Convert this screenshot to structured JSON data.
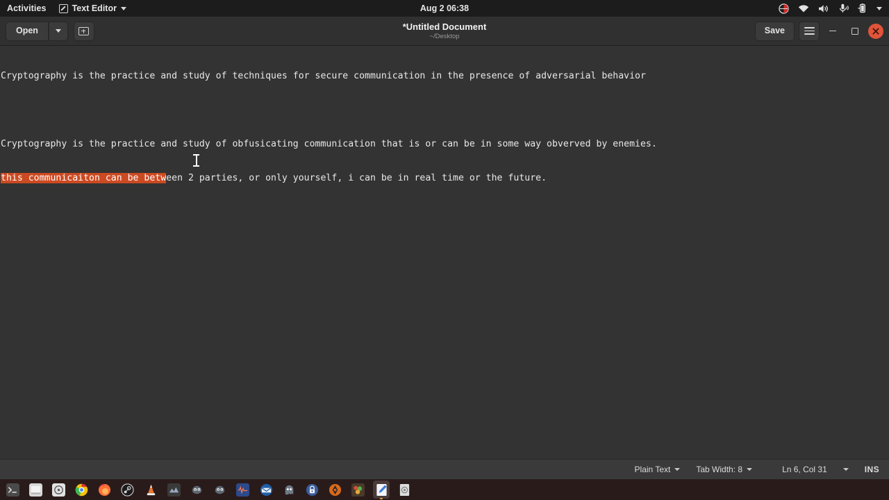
{
  "topbar": {
    "activities": "Activities",
    "app_name": "Text Editor",
    "app_icon": "text-editor-icon",
    "clock": "Aug 2  06:38",
    "tray": [
      {
        "name": "screencast-recording-icon"
      },
      {
        "name": "wifi-icon"
      },
      {
        "name": "volume-icon"
      },
      {
        "name": "microphone-icon"
      },
      {
        "name": "battery-icon"
      },
      {
        "name": "system-menu-chevron-icon"
      }
    ]
  },
  "headerbar": {
    "open_label": "Open",
    "open_dropdown_icon": "chevron-down-icon",
    "new_document_icon": "new-document-icon",
    "title": "*Untitled Document",
    "subtitle": "~/Desktop",
    "save_label": "Save",
    "menu_icon": "hamburger-menu-icon",
    "minimize_icon": "minimize-icon",
    "maximize_icon": "maximize-icon",
    "close_icon": "close-icon",
    "close_color": "#e0543a"
  },
  "editor": {
    "background": "#333333",
    "text_color": "#e8e8e8",
    "selection_color": "#cc4a22",
    "lines": [
      {
        "type": "text",
        "text": "Cryptography is the practice and study of techniques for secure communication in the presence of adversarial behavior"
      },
      {
        "type": "blank",
        "text": ""
      },
      {
        "type": "text",
        "text": "Cryptography is the practice and study of obfusicating communication that is or can be in some way obverved by enemies."
      },
      {
        "type": "split",
        "selected": "this communicaiton can be betw",
        "rest": "een 2 parties, or only yourself, i can be in real time or the future."
      }
    ]
  },
  "statusbar": {
    "language": "Plain Text",
    "tab_width": "Tab Width: 8",
    "position": "Ln 6, Col 31",
    "overwrite_mode": "INS"
  },
  "dock": {
    "items": [
      {
        "name": "terminal",
        "icon": "terminal-icon",
        "active": false
      },
      {
        "name": "files",
        "icon": "files-icon",
        "active": false
      },
      {
        "name": "disks",
        "icon": "disks-icon",
        "active": false
      },
      {
        "name": "google-chrome",
        "icon": "chrome-icon",
        "active": false
      },
      {
        "name": "firefox",
        "icon": "firefox-icon",
        "active": false
      },
      {
        "name": "steam",
        "icon": "steam-icon",
        "active": false
      },
      {
        "name": "vlc",
        "icon": "vlc-icon",
        "active": false
      },
      {
        "name": "app-dark-1",
        "icon": "app-icon",
        "active": false
      },
      {
        "name": "gimp",
        "icon": "gimp-icon",
        "active": false
      },
      {
        "name": "gimp-2",
        "icon": "gimp-icon",
        "active": false
      },
      {
        "name": "audio-editor",
        "icon": "audio-editor-icon",
        "active": false
      },
      {
        "name": "thunderbird",
        "icon": "mail-icon",
        "active": false
      },
      {
        "name": "ghost-app",
        "icon": "ghost-icon",
        "active": false
      },
      {
        "name": "password-manager",
        "icon": "lock-icon",
        "active": false
      },
      {
        "name": "virtualbox",
        "icon": "virtualbox-icon",
        "active": false
      },
      {
        "name": "photo-app",
        "icon": "photos-icon",
        "active": false
      },
      {
        "name": "text-editor",
        "icon": "text-editor-icon",
        "active": true
      },
      {
        "name": "software",
        "icon": "software-icon",
        "active": false
      }
    ]
  }
}
